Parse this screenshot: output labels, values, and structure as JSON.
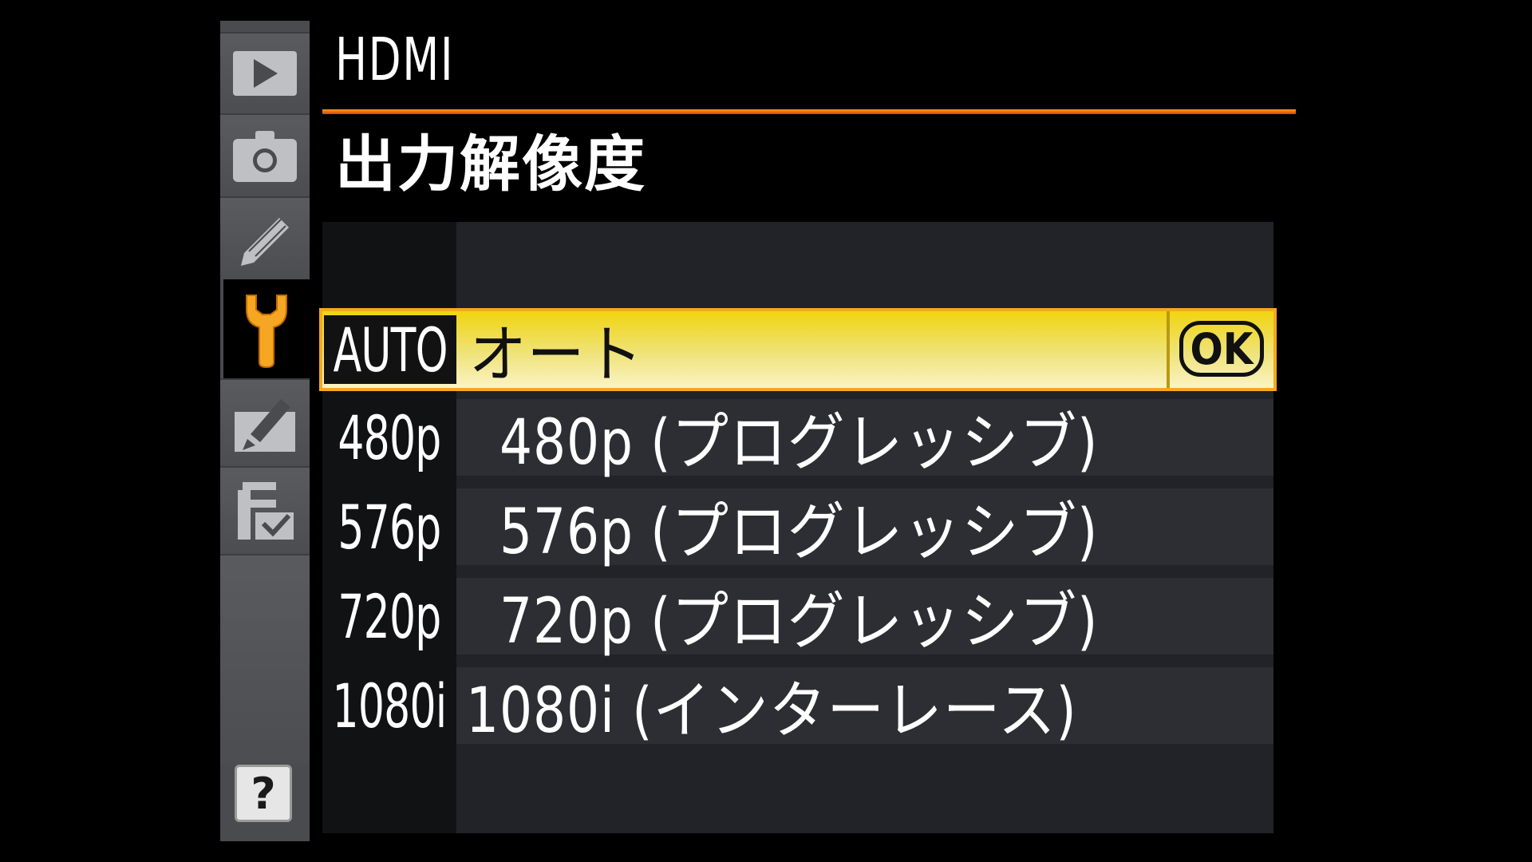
{
  "header": {
    "title": "HDMI",
    "subtitle": "出力解像度"
  },
  "sidebar": {
    "tabs": [
      {
        "name": "playback-menu",
        "icon": "play-icon",
        "active": false
      },
      {
        "name": "shooting-menu",
        "icon": "camera-icon",
        "active": false
      },
      {
        "name": "custom-settings-menu",
        "icon": "pencil-icon",
        "active": false
      },
      {
        "name": "setup-menu",
        "icon": "wrench-icon",
        "active": true
      },
      {
        "name": "retouch-menu",
        "icon": "retouch-brush-icon",
        "active": false
      },
      {
        "name": "my-menu",
        "icon": "my-menu-check-icon",
        "active": false
      }
    ],
    "help_label": "?"
  },
  "options": [
    {
      "key": "AUTO",
      "label": "オート",
      "selected": true
    },
    {
      "key": "480p",
      "label": "480p (プログレッシブ)",
      "selected": false
    },
    {
      "key": "576p",
      "label": "576p (プログレッシブ)",
      "selected": false
    },
    {
      "key": "720p",
      "label": "720p (プログレッシブ)",
      "selected": false
    },
    {
      "key": "1080i",
      "label": "1080i (インターレース)",
      "selected": false
    }
  ],
  "ok_label": "OK",
  "colors": {
    "accent_rule": "#f08a10",
    "active_icon": "#f5a623",
    "highlight": "#f1d410"
  }
}
